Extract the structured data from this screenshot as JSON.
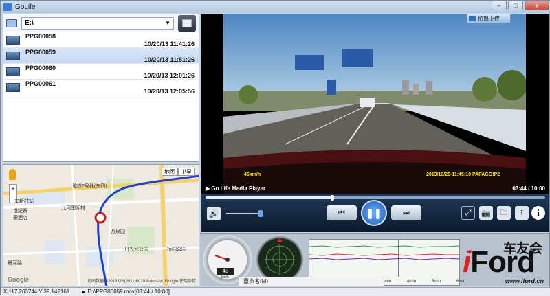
{
  "window": {
    "title": "GoLife",
    "close_label": "x",
    "min_label": "–",
    "max_label": "□"
  },
  "drive": {
    "selected": "E:\\"
  },
  "files": [
    {
      "name": "PPG00058",
      "date": "10/20/13 11:41:26",
      "selected": false
    },
    {
      "name": "PPG00059",
      "date": "10/20/13 11:51:26",
      "selected": true
    },
    {
      "name": "PPG00060",
      "date": "10/20/13 12:01:26",
      "selected": false
    },
    {
      "name": "PPG00061",
      "date": "10/20/13 12:05:56",
      "selected": false
    }
  ],
  "map": {
    "type_map": "地图",
    "type_satellite": "卫星",
    "zoom_in": "+",
    "zoom_out": "-",
    "labels": {
      "subway": "地铁2号线(东四)",
      "station": "车新村站",
      "park": "九河国际村",
      "hotel": "世纪泰\n豪酒店",
      "park2": "万泉园",
      "road": "日光河公园",
      "bridge": "桥园公园",
      "area": "晨河路"
    },
    "logo": "Google",
    "copyright": "地图数据 ©2013 GS(2011)6020 AutoNavi, Google  使用条款"
  },
  "video": {
    "upload_label": "拍摄上传",
    "speed_overlay": "46km/h",
    "timestamp_overlay": "2013/10/20-11:45:10 PAPAGO!P2",
    "player_title": "Go Life Media Player",
    "time": "03:44 / 10:00",
    "progress": 0.373,
    "volume": 0.9
  },
  "controls": {
    "prev": "⏮",
    "pause": "❚❚",
    "next": "⏭",
    "fullscreen": "⤢",
    "snapshot": "📷",
    "folder": "🗀",
    "upload": "⭱",
    "info": "i",
    "volume_icon": "🔊"
  },
  "gauges": {
    "speed": "43",
    "speed_unit": "km/h"
  },
  "gsensor": {
    "ticks": [
      "1min",
      "2min",
      "3min",
      "4min",
      "5min",
      "6min"
    ]
  },
  "rename_popup": "重命名(M)",
  "status": {
    "coords": "X:117.263744 Y:39.142161",
    "file": "E:\\\\PPG00059.mov[03:44 / 10:00]"
  },
  "watermark": {
    "chinese": "车友会",
    "brand": "iFord",
    "url": "www.iford.cn"
  }
}
